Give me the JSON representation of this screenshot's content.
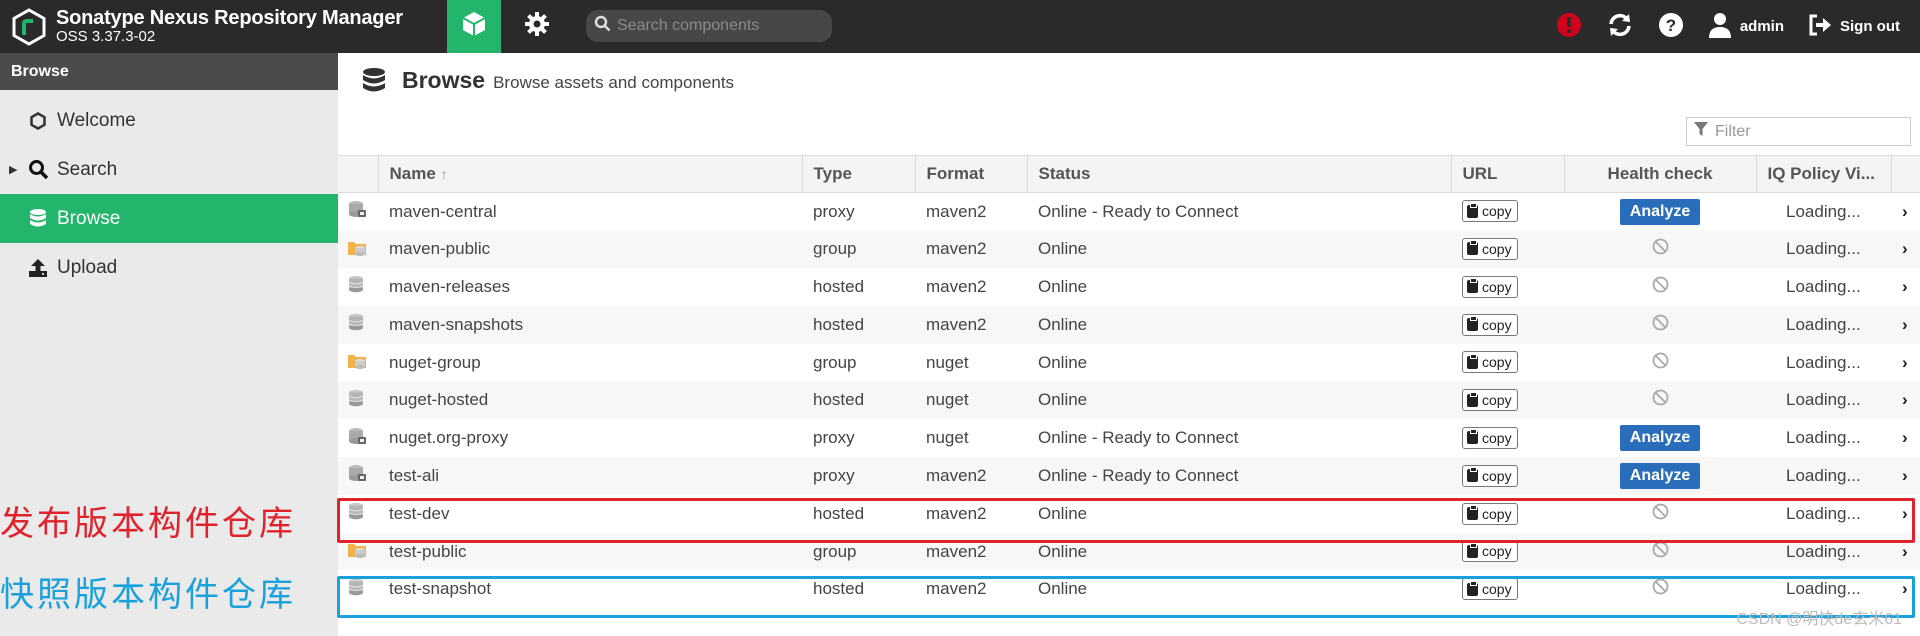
{
  "app": {
    "name": "Sonatype Nexus Repository Manager",
    "version": "OSS 3.37.3-02"
  },
  "header": {
    "search_placeholder": "Search components",
    "user": "admin",
    "sign_out": "Sign out",
    "accent": "#22b56b",
    "alert_color": "#d0021b"
  },
  "sidebar": {
    "title": "Browse",
    "items": [
      {
        "label": "Welcome",
        "icon": "hexagon-icon"
      },
      {
        "label": "Search",
        "icon": "search-icon"
      },
      {
        "label": "Browse",
        "icon": "database-icon",
        "active": true
      },
      {
        "label": "Upload",
        "icon": "upload-icon"
      }
    ]
  },
  "main": {
    "title": "Browse",
    "subtitle": "Browse assets and components",
    "filter_placeholder": "Filter",
    "columns": [
      "Name",
      "Type",
      "Format",
      "Status",
      "URL",
      "Health check",
      "IQ Policy Vi..."
    ],
    "sort_indicator": "↑",
    "copy_label": "copy",
    "analyze_label": "Analyze",
    "loading_label": "Loading...",
    "rows": [
      {
        "name": "maven-central",
        "type": "proxy",
        "format": "maven2",
        "status": "Online - Ready to Connect",
        "health": "analyze"
      },
      {
        "name": "maven-public",
        "type": "group",
        "format": "maven2",
        "status": "Online",
        "health": "disabled"
      },
      {
        "name": "maven-releases",
        "type": "hosted",
        "format": "maven2",
        "status": "Online",
        "health": "disabled"
      },
      {
        "name": "maven-snapshots",
        "type": "hosted",
        "format": "maven2",
        "status": "Online",
        "health": "disabled"
      },
      {
        "name": "nuget-group",
        "type": "group",
        "format": "nuget",
        "status": "Online",
        "health": "disabled"
      },
      {
        "name": "nuget-hosted",
        "type": "hosted",
        "format": "nuget",
        "status": "Online",
        "health": "disabled"
      },
      {
        "name": "nuget.org-proxy",
        "type": "proxy",
        "format": "nuget",
        "status": "Online - Ready to Connect",
        "health": "analyze"
      },
      {
        "name": "test-ali",
        "type": "proxy",
        "format": "maven2",
        "status": "Online - Ready to Connect",
        "health": "analyze"
      },
      {
        "name": "test-dev",
        "type": "hosted",
        "format": "maven2",
        "status": "Online",
        "health": "disabled"
      },
      {
        "name": "test-public",
        "type": "group",
        "format": "maven2",
        "status": "Online",
        "health": "disabled"
      },
      {
        "name": "test-snapshot",
        "type": "hosted",
        "format": "maven2",
        "status": "Online",
        "health": "disabled"
      }
    ]
  },
  "annotations": {
    "release_label": "发布版本构件仓库",
    "snapshot_label": "快照版本构件仓库",
    "release_color": "#e0222c",
    "snapshot_color": "#1aa1db"
  },
  "watermark": "CSDN @明快de玄米61"
}
